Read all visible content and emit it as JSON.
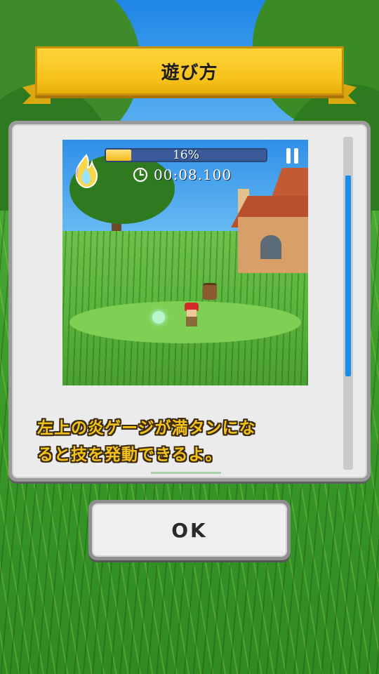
{
  "title_banner": {
    "title": "遊び方"
  },
  "tutorial": {
    "preview_hud": {
      "gauge_percent_label": "16%",
      "gauge_fill_fraction": 0.16,
      "timer": "00:08.100",
      "icons": [
        "flame-icon",
        "pause-icon",
        "clock-icon"
      ]
    },
    "description_line1": "左上の炎ゲージが満タンにな",
    "description_line2": "ると技を発動できるよ。"
  },
  "buttons": {
    "ok_label": "OK"
  },
  "colors": {
    "banner_yellow": "#f6c21a",
    "text_yellow": "#f2c21a",
    "scrollbar_blue": "#1a8de8",
    "panel_gray": "#ebebeb"
  }
}
